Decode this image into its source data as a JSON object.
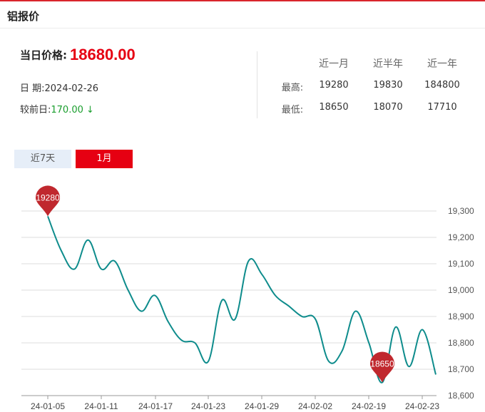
{
  "header": {
    "title": "铝报价"
  },
  "summary": {
    "price_label": "当日价格:",
    "price": "18680.00",
    "date_label": "日 期:",
    "date": "2024-02-26",
    "change_label": "较前日:",
    "change": "170.00",
    "change_arrow": "↓",
    "down_color": "#1a9e2e",
    "price_color": "#e60012"
  },
  "stats": {
    "columns": [
      "近一月",
      "近半年",
      "近一年"
    ],
    "rows": [
      {
        "label": "最高:",
        "values": [
          "19280",
          "19830",
          "184800"
        ]
      },
      {
        "label": "最低:",
        "values": [
          "18650",
          "18070",
          "17710"
        ]
      }
    ]
  },
  "tabs": [
    {
      "label": "近7天",
      "active": false
    },
    {
      "label": "1月",
      "active": true
    }
  ],
  "chart_data": {
    "type": "line",
    "x_tick_labels": [
      "24-01-05",
      "24-01-11",
      "24-01-17",
      "24-01-23",
      "24-01-29",
      "24-02-02",
      "24-02-19",
      "24-02-23"
    ],
    "y_ticks": [
      18600,
      18700,
      18800,
      18900,
      19000,
      19100,
      19200,
      19300
    ],
    "y_tick_labels": [
      "18,600",
      "18,700",
      "18,800",
      "18,900",
      "19,000",
      "19,100",
      "19,200",
      "19,300"
    ],
    "ylim": [
      18600,
      19300
    ],
    "grid": true,
    "line_color": "#0e8c8c",
    "marker_color": "#c0282e",
    "series": [
      {
        "values": [
          19280,
          19150,
          19080,
          19190,
          19080,
          19110,
          19000,
          18920,
          18980,
          18880,
          18810,
          18800,
          18730,
          18960,
          18890,
          19110,
          19060,
          18980,
          18940,
          18900,
          18890,
          18730,
          18770,
          18920,
          18800,
          18650,
          18860,
          18710,
          18850,
          18680
        ]
      }
    ],
    "annotations": [
      {
        "label": "19280",
        "point_index": 0,
        "kind": "max"
      },
      {
        "label": "18650",
        "point_index": 25,
        "kind": "min"
      }
    ]
  }
}
